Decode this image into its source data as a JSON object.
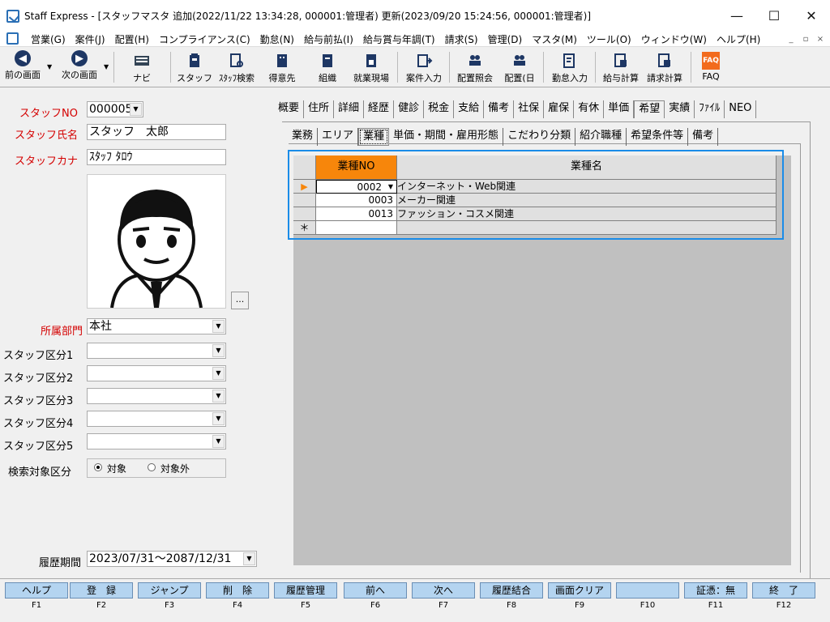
{
  "window": {
    "title": "Staff Express - [スタッフマスタ 追加(2022/11/22 13:34:28, 000001:管理者) 更新(2023/09/20 15:24:56, 000001:管理者)]"
  },
  "menu": [
    "営業(G)",
    "案件(J)",
    "配置(H)",
    "コンプライアンス(C)",
    "勤怠(N)",
    "給与前払(I)",
    "給与賞与年調(T)",
    "請求(S)",
    "管理(D)",
    "マスタ(M)",
    "ツール(O)",
    "ウィンドウ(W)",
    "ヘルプ(H)"
  ],
  "toolbar": {
    "prev": "前の画面",
    "next": "次の画面",
    "navi": "ナビ",
    "staff": "スタッフ",
    "staff_search": "ｽﾀｯﾌ検索",
    "client": "得意先",
    "org": "組織",
    "site": "就業現場",
    "case_input": "案件入力",
    "assign_query": "配置照会",
    "assign_day": "配置(日",
    "attendance": "勤怠入力",
    "payroll": "給与計算",
    "billing": "請求計算",
    "faq": "FAQ"
  },
  "form": {
    "staff_no_label": "スタッフNO",
    "staff_no": "000005",
    "staff_name_label": "スタッフ氏名",
    "staff_name": "スタッフ　太郎",
    "staff_kana_label": "スタッフカナ",
    "staff_kana": "ｽﾀｯﾌ ﾀﾛｳ",
    "photo_button": "...",
    "dept_label": "所属部門",
    "dept": "本社",
    "class1_label": "スタッフ区分1",
    "class2_label": "スタッフ区分2",
    "class3_label": "スタッフ区分3",
    "class4_label": "スタッフ区分4",
    "class5_label": "スタッフ区分5",
    "search_label": "検索対象区分",
    "radio_on": "対象",
    "radio_off": "対象外",
    "history_label": "履歴期間",
    "history": "2023/07/31～2087/12/31"
  },
  "tabs_main": [
    "概要",
    "住所",
    "詳細",
    "経歴",
    "健診",
    "税金",
    "支給",
    "備考",
    "社保",
    "雇保",
    "有休",
    "単価",
    "希望",
    "実績",
    "ﾌｧｲﾙ",
    "NEO"
  ],
  "tabs_main_active": "希望",
  "tabs_sub": [
    "業務",
    "エリア",
    "業種",
    "単価・期間・雇用形態",
    "こだわり分類",
    "紹介職種",
    "希望条件等",
    "備考"
  ],
  "tabs_sub_active": "業種",
  "grid": {
    "headers": [
      "業種NO",
      "業種名"
    ],
    "rows": [
      {
        "no": "0002",
        "name": "インターネット・Web関連"
      },
      {
        "no": "0003",
        "name": "メーカー関連"
      },
      {
        "no": "0013",
        "name": "ファッション・コスメ関連"
      }
    ],
    "new_row_marker": "＊"
  },
  "fkeys": [
    {
      "label": "ヘルプ",
      "key": "F1"
    },
    {
      "label": "登　録",
      "key": "F2"
    },
    {
      "label": "ジャンプ",
      "key": "F3"
    },
    {
      "label": "削　除",
      "key": "F4"
    },
    {
      "label": "履歴管理",
      "key": "F5"
    },
    {
      "label": "前へ",
      "key": "F6"
    },
    {
      "label": "次へ",
      "key": "F7"
    },
    {
      "label": "履歴結合",
      "key": "F8"
    },
    {
      "label": "画面クリア",
      "key": "F9"
    },
    {
      "label": "",
      "key": "F10"
    },
    {
      "label": "証憑：無",
      "key": "F11"
    },
    {
      "label": "終　了",
      "key": "F12"
    }
  ],
  "colors": {
    "accent": "#1a8ce8",
    "header_orange": "#f7860b",
    "required_red": "#d40000",
    "fkey_blue": "#b4d4f0"
  }
}
